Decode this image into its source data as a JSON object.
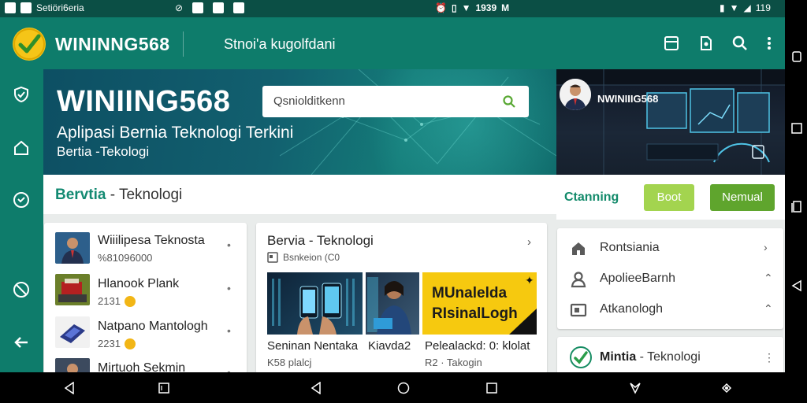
{
  "status_bar": {
    "app_label": "Setiöri6eria",
    "time": "1939",
    "extra": "M",
    "battery_text": "119"
  },
  "app_bar": {
    "title": "WININNG568",
    "subtitle": "Stnoi'a kugolfdani"
  },
  "hero": {
    "title": "WINIING568",
    "subtitle": "Aplipasi Bernia Teknologi Terkini",
    "tagline": "Bertia -Tekologi",
    "search_value": "Qsniolditkenn"
  },
  "promo": {
    "caption": "NWINIIIG568"
  },
  "section": {
    "title_primary": "Bervtia",
    "title_separator": " - ",
    "title_secondary": "Teknologi"
  },
  "actions": {
    "channel_label": "Ctanning",
    "boost_label": "Boot",
    "normal_label": "Nemual"
  },
  "list": [
    {
      "title": "Wiiilipesa Teknosta",
      "meta": "%81096000",
      "coin": false
    },
    {
      "title": "Hlanook Plank",
      "meta": "2131",
      "coin": true
    },
    {
      "title": "Natpano Mantologh",
      "meta": "2231",
      "coin": true
    },
    {
      "title": "Mirtuoh Sekmin",
      "meta": "",
      "coin": false
    }
  ],
  "news": {
    "title": "Bervia - Teknologi",
    "source": "Bsnkeion (C0",
    "image3_text_line1": "MUnalelda",
    "image3_text_line2": "RIsinalLogh",
    "captions": [
      {
        "title": "Seninan Nentaka",
        "sub": "K58 plalcj"
      },
      {
        "title": "Kiavda2",
        "sub": ""
      },
      {
        "title": "Pelealackd: 0: klolat",
        "sub": "R2 · Takogin"
      }
    ]
  },
  "menu": [
    {
      "label": "Rontsiania",
      "icon": "home-icon",
      "control": "›"
    },
    {
      "label": "ApolieeBarnh",
      "icon": "person-icon",
      "control": "⌃"
    },
    {
      "label": "Atkanologh",
      "icon": "monitor-icon",
      "control": "⌃"
    }
  ],
  "category": {
    "label_bold": "Mintia",
    "label_rest": " - Teknologi"
  },
  "colors": {
    "primary": "#0e7c6b",
    "status_bar": "#0b4f45",
    "accent_green": "#5fa52d",
    "accent_light": "#a3d44f",
    "logo_yellow": "#f5c518",
    "card_yellow": "#f6c90f"
  }
}
